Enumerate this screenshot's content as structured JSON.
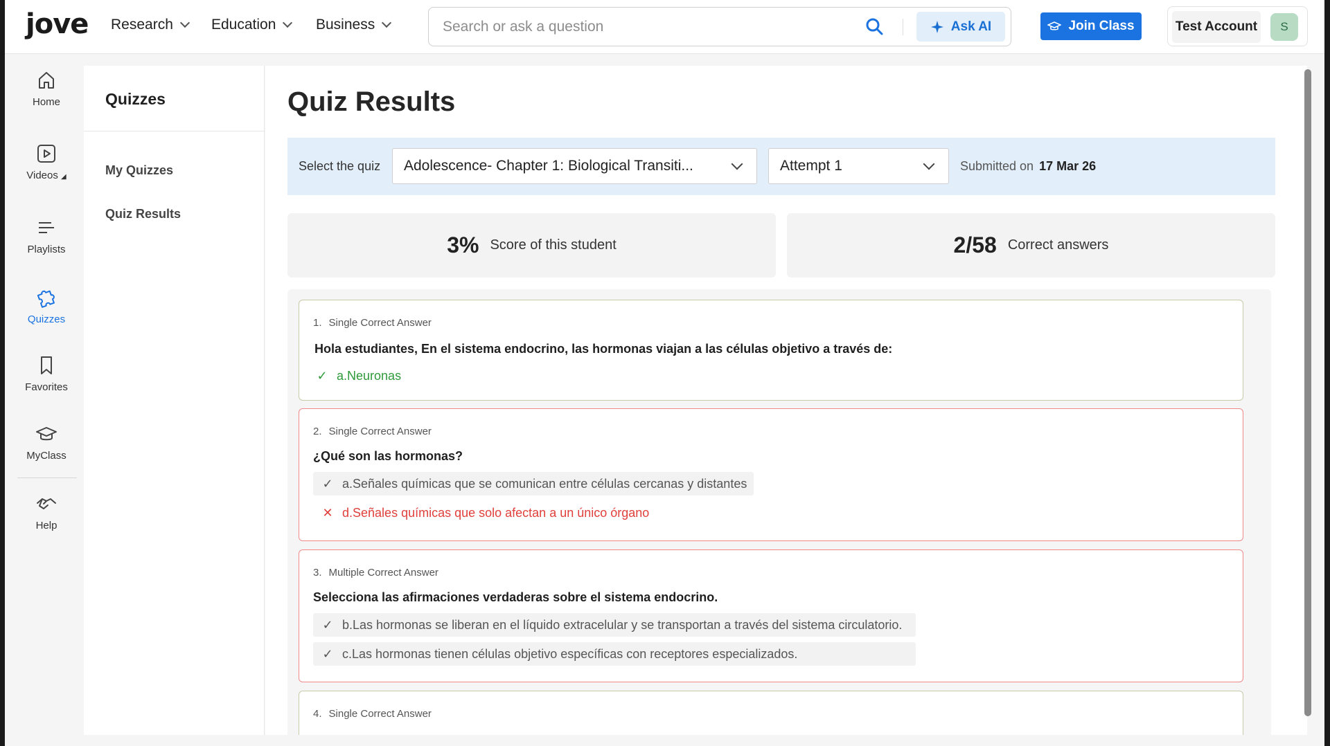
{
  "brand": {
    "logo_text": "jove"
  },
  "topnav": {
    "menus": [
      {
        "label": "Research"
      },
      {
        "label": "Education"
      },
      {
        "label": "Business"
      }
    ],
    "search": {
      "placeholder": "Search or ask a question",
      "value": ""
    },
    "ask_ai_label": "Ask AI",
    "join_class_label": "Join Class",
    "account_name": "Test Account",
    "avatar_initial": "S"
  },
  "rail": {
    "items": [
      {
        "label": "Home",
        "icon": "home-icon"
      },
      {
        "label": "Videos",
        "icon": "video-icon"
      },
      {
        "label": "Playlists",
        "icon": "playlist-icon"
      },
      {
        "label": "Quizzes",
        "icon": "puzzle-icon",
        "active": true
      },
      {
        "label": "Favorites",
        "icon": "bookmark-icon"
      },
      {
        "label": "MyClass",
        "icon": "graduation-cap-icon"
      },
      {
        "label": "Help",
        "icon": "handshake-icon"
      }
    ]
  },
  "sidebar": {
    "title": "Quizzes",
    "items": [
      {
        "label": "My Quizzes"
      },
      {
        "label": "Quiz Results"
      }
    ]
  },
  "main": {
    "title": "Quiz Results",
    "filter": {
      "select_label": "Select the quiz",
      "quiz_value": "Adolescence- Chapter 1: Biological Transiti...",
      "attempt_value": "Attempt 1",
      "submitted_label": "Submitted on",
      "submitted_date": "17 Mar 26"
    },
    "stats": {
      "score_value": "3%",
      "score_label": "Score of this student",
      "correct_value": "2/58",
      "correct_label": "Correct answers"
    },
    "questions": [
      {
        "number": "1.",
        "type": "Single Correct Answer",
        "text": "Hola estudiantes, En el sistema endocrino, las hormonas viajan a las células objetivo a través de:",
        "options": [
          {
            "letter": "a.",
            "text": "Neuronas",
            "state": "correct"
          }
        ]
      },
      {
        "number": "2.",
        "type": "Single Correct Answer",
        "text": "¿Qué son las hormonas?",
        "options": [
          {
            "letter": "a.",
            "text": "Señales químicas que se comunican entre células cercanas y distantes",
            "state": "answer"
          },
          {
            "letter": "d.",
            "text": "Señales químicas que solo afectan a un único órgano",
            "state": "wrong"
          }
        ]
      },
      {
        "number": "3.",
        "type": "Multiple Correct Answer",
        "text": "Selecciona las afirmaciones verdaderas sobre el sistema endocrino.",
        "options": [
          {
            "letter": "b.",
            "text": "Las hormonas se liberan en el líquido extracelular y se transportan a través del sistema circulatorio.",
            "state": "answer"
          },
          {
            "letter": "c.",
            "text": "Las hormonas tienen células objetivo específicas con receptores especializados.",
            "state": "answer"
          }
        ]
      },
      {
        "number": "4.",
        "type": "Single Correct Answer",
        "text": "",
        "options": []
      }
    ]
  },
  "colors": {
    "accent": "#1a73e0",
    "correct": "#2e9a3a",
    "wrong": "#e0403b",
    "filter_bg": "#e2eef9"
  }
}
